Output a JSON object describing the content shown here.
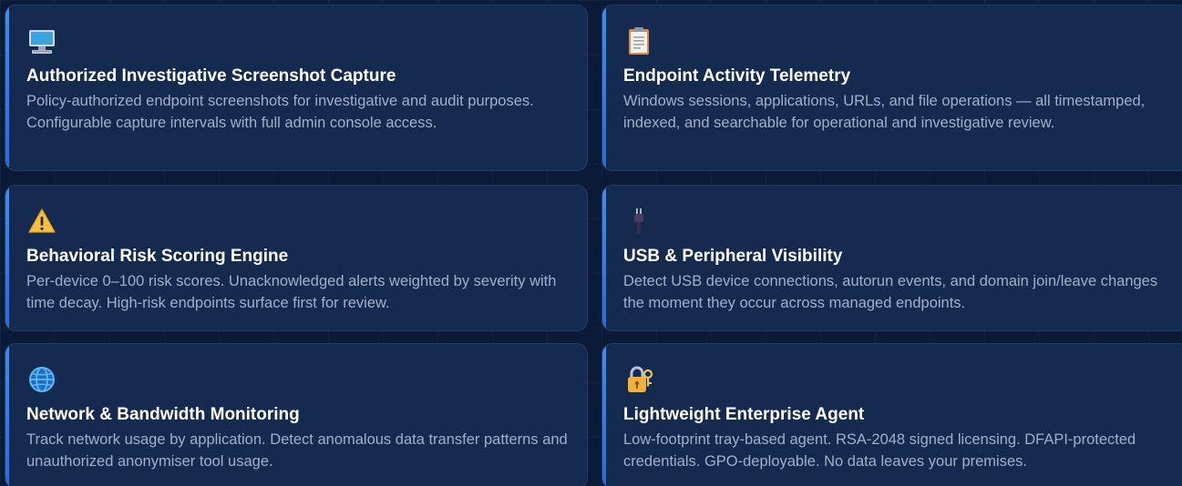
{
  "features": [
    {
      "icon": "desktop-computer-icon",
      "title": "Authorized Investigative Screenshot Capture",
      "desc": "Policy-authorized endpoint screenshots for investigative and audit purposes. Configurable capture intervals with full admin console access."
    },
    {
      "icon": "clipboard-icon",
      "title": "Endpoint Activity Telemetry",
      "desc": "Windows sessions, applications, URLs, and file operations — all timestamped, indexed, and searchable for operational and investigative review."
    },
    {
      "icon": "warning-icon",
      "title": "Behavioral Risk Scoring Engine",
      "desc": "Per-device 0–100 risk scores. Unacknowledged alerts weighted by severity with time decay. High-risk endpoints surface first for review."
    },
    {
      "icon": "usb-plug-icon",
      "title": "USB & Peripheral Visibility",
      "desc": "Detect USB device connections, autorun events, and domain join/leave changes the moment they occur across managed endpoints."
    },
    {
      "icon": "globe-icon",
      "title": "Network & Bandwidth Monitoring",
      "desc": "Track network usage by application. Detect anomalous data transfer patterns and unauthorized anonymiser tool usage."
    },
    {
      "icon": "lock-with-key-icon",
      "title": "Lightweight Enterprise Agent",
      "desc": "Low-footprint tray-based agent. RSA-2048 signed licensing. DFAPI-protected credentials. GPO-deployable. No data leaves your premises."
    }
  ]
}
